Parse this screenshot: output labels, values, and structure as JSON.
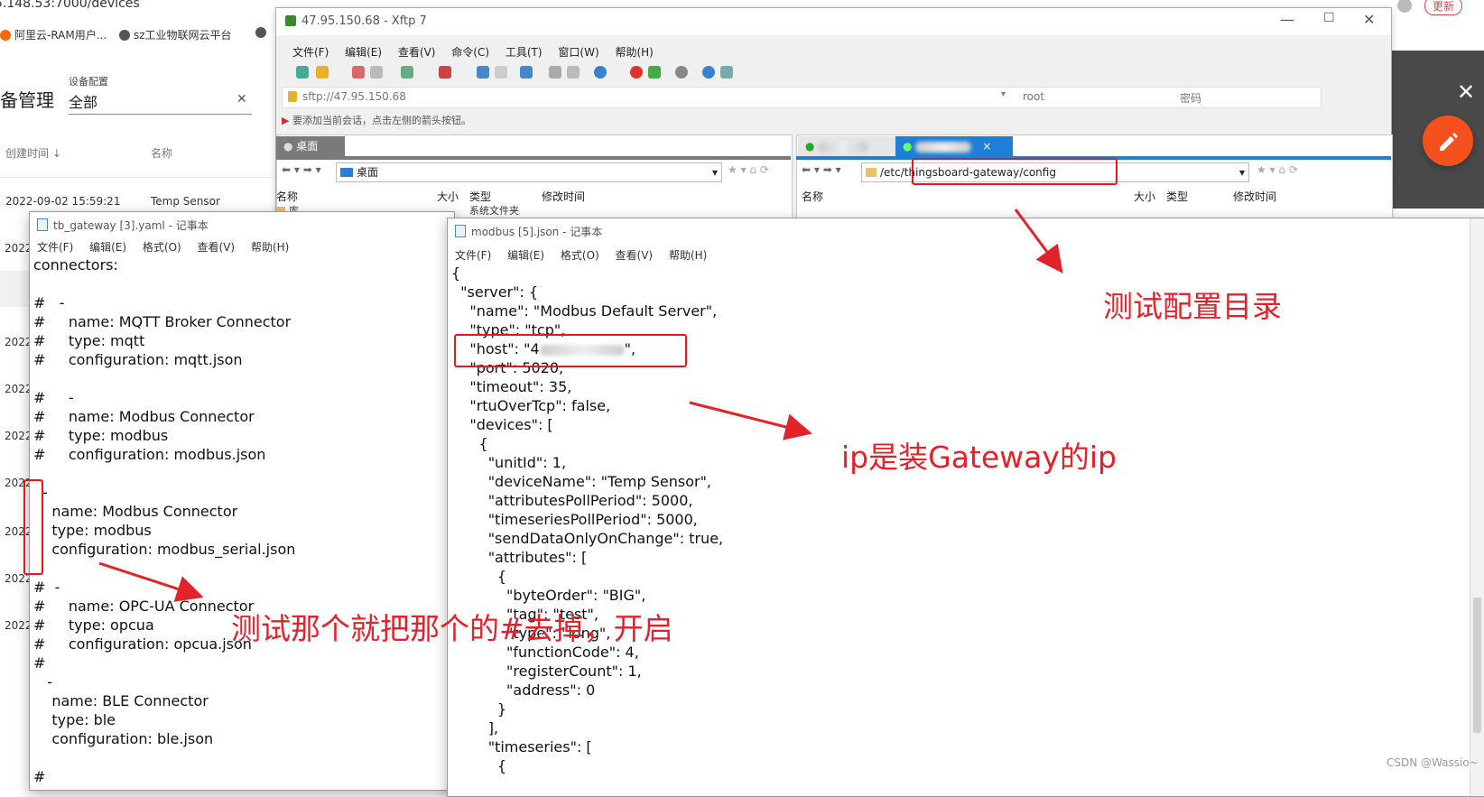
{
  "browser": {
    "url": "5.148.53:7000/devices",
    "bookmarks": [
      "阿里云-RAM用户...",
      "sz工业物联网云平台"
    ],
    "update_btn": "更新",
    "page_title": "备管理",
    "filter": {
      "label": "设备配置",
      "value": "全部"
    },
    "columns": {
      "created": "创建时间",
      "name": "名称"
    },
    "first_row": {
      "date": "2022-09-02 15:59:21",
      "name": "Temp Sensor"
    },
    "row_year": "2022",
    "fab_icon": "pencil-icon",
    "close_icon": "close-icon"
  },
  "xftp": {
    "title": "47.95.150.68 - Xftp 7",
    "menus": [
      "文件(F)",
      "编辑(E)",
      "查看(V)",
      "命令(C)",
      "工具(T)",
      "窗口(W)",
      "帮助(H)"
    ],
    "address": "sftp://47.95.150.68",
    "user": "root",
    "password_placeholder": "密码",
    "hint": "要添加当前会话，点击左侧的箭头按钮。",
    "left_tab": "桌面",
    "left_path": "桌面",
    "right_path": "/etc/thingsboard-gateway/config",
    "headers": {
      "name": "名称",
      "size": "大小",
      "type": "类型",
      "modified": "修改时间"
    },
    "left_row_name": "库",
    "left_row_type": "系统文件夹"
  },
  "notepad_left": {
    "title": "tb_gateway [3].yaml - 记事本",
    "menus": [
      "文件(F)",
      "编辑(E)",
      "格式(O)",
      "查看(V)",
      "帮助(H)"
    ],
    "content": "connectors:\n\n#   -\n#     name: MQTT Broker Connector\n#     type: mqtt\n#     configuration: mqtt.json\n\n#     -\n#     name: Modbus Connector\n#     type: modbus\n#     configuration: modbus.json\n\n  -\n    name: Modbus Connector\n    type: modbus\n    configuration: modbus_serial.json\n\n#  -\n#     name: OPC-UA Connector\n#     type: opcua\n#     configuration: opcua.json\n#\n   -\n    name: BLE Connector\n    type: ble\n    configuration: ble.json\n\n#"
  },
  "notepad_right": {
    "title": "modbus [5].json - 记事本",
    "menus": [
      "文件(F)",
      "编辑(E)",
      "格式(O)",
      "查看(V)",
      "帮助(H)"
    ],
    "content_before_host": "{\n  \"server\": {\n    \"name\": \"Modbus Default Server\",\n    \"type\": \"tcp\",",
    "host_prefix": "    \"host\": \"4",
    "host_suffix": "\",",
    "content_after_host": "    \"port\": 5020,\n    \"timeout\": 35,\n    \"rtuOverTcp\": false,\n    \"devices\": [\n      {\n        \"unitId\": 1,\n        \"deviceName\": \"Temp Sensor\",\n        \"attributesPollPeriod\": 5000,\n        \"timeseriesPollPeriod\": 5000,\n        \"sendDataOnlyOnChange\": true,\n        \"attributes\": [\n          {\n            \"byteOrder\": \"BIG\",\n            \"tag\": \"test\",\n            \"type\": \"long\",\n            \"functionCode\": 4,\n            \"registerCount\": 1,\n            \"address\": 0\n          }\n        ],\n        \"timeseries\": [\n          {"
  },
  "annotations": {
    "config_dir": "测试配置目录",
    "ip_note": "ip是装Gateway的ip",
    "enable_note": "测试那个就把那个的#去掉，开启"
  },
  "watermark": "CSDN @Wassio~",
  "colors": {
    "annotation_red": "#e4222a",
    "fab_orange": "#f4511e",
    "xftp_tab_active": "#1e7fd6"
  }
}
